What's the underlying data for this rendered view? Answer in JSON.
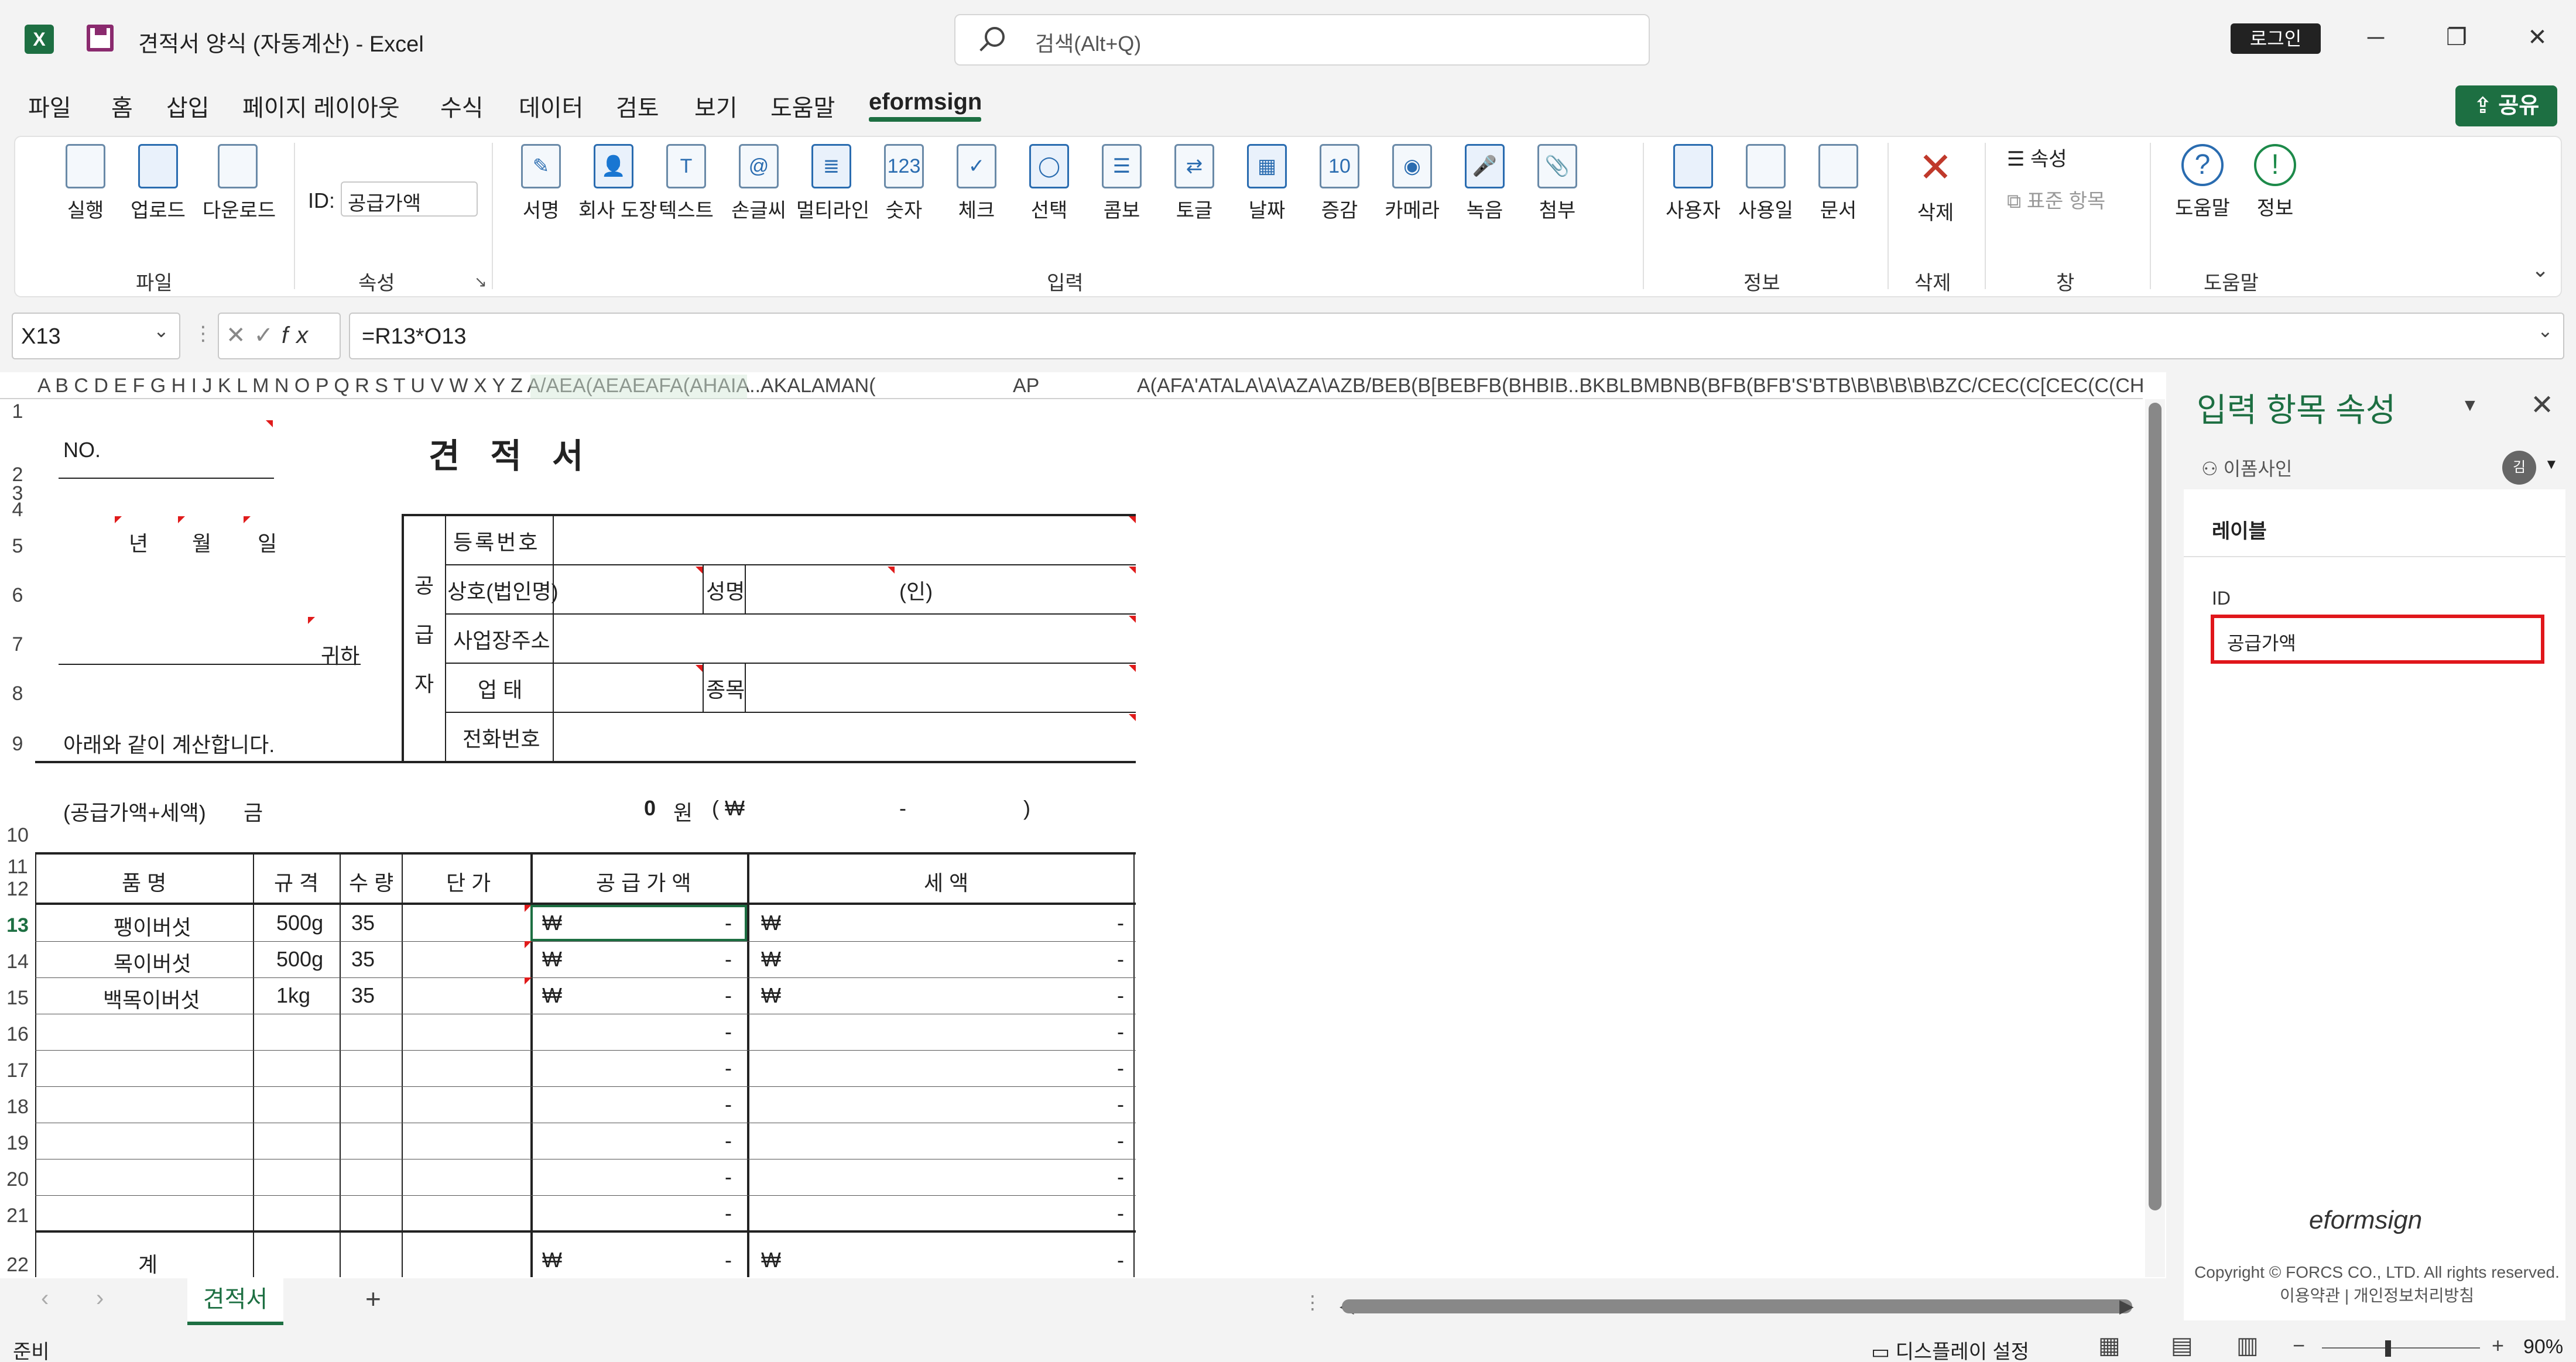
{
  "window": {
    "title": "견적서 양식 (자동계산)  -  Excel",
    "search_placeholder": "검색(Alt+Q)",
    "login": "로그인"
  },
  "menu": {
    "items": [
      "파일",
      "홈",
      "삽입",
      "페이지 레이아웃",
      "수식",
      "데이터",
      "검토",
      "보기",
      "도움말",
      "eformsign"
    ],
    "share": "공유"
  },
  "ribbon": {
    "file_group": {
      "name": "파일",
      "buttons": [
        "실행",
        "업로드",
        "다운로드"
      ]
    },
    "property_group": {
      "name": "속성",
      "id_label": "ID:",
      "id_value": "공급가액"
    },
    "input_group": {
      "name": "입력",
      "buttons": [
        "서명",
        "회사 도장",
        "텍스트",
        "손글씨",
        "멀티라인",
        "숫자",
        "체크",
        "선택",
        "콤보",
        "토글",
        "날짜",
        "증감",
        "카메라",
        "녹음",
        "첨부"
      ]
    },
    "info_group": {
      "name": "정보",
      "buttons": [
        "사용자",
        "사용일",
        "문서"
      ]
    },
    "delete_group": {
      "name": "삭제",
      "buttons": [
        "삭제"
      ]
    },
    "window_group": {
      "name": "창",
      "buttons": [
        "속성",
        "표준 항목"
      ]
    },
    "help_group": {
      "name": "도움말",
      "buttons": [
        "도움말",
        "정보"
      ]
    }
  },
  "formula": {
    "name_box": "X13",
    "formula": "=R13*O13"
  },
  "sheet": {
    "title": "견 적 서",
    "no_label": "NO.",
    "date": {
      "year": "년",
      "month": "월",
      "day": "일"
    },
    "to": "귀하",
    "note": "아래와 같이 계산합니다.",
    "supplier_label": [
      "공",
      "급",
      "자"
    ],
    "supplier_fields": {
      "reg_no": "등록번호",
      "company": "상호(법인명)",
      "name": "성명",
      "seal": "(인)",
      "address": "사업장주소",
      "business": "업 태",
      "item": "종목",
      "phone": "전화번호"
    },
    "total_row": {
      "label": "(공급가액+세액)",
      "amount_label": "금",
      "amount": "0",
      "won": "원",
      "open": "( ₩",
      "dash": "-",
      "close": ")"
    },
    "headers": [
      "품 명",
      "규 격",
      "수 량",
      "단 가",
      "공 급 가 액",
      "세 액"
    ],
    "items": [
      {
        "name": "팽이버섯",
        "spec": "500g",
        "qty": "35",
        "cur": "₩",
        "val": "-",
        "tcur": "₩",
        "tval": "-"
      },
      {
        "name": "목이버섯",
        "spec": "500g",
        "qty": "35",
        "cur": "₩",
        "val": "-",
        "tcur": "₩",
        "tval": "-"
      },
      {
        "name": "백목이버섯",
        "spec": "1kg",
        "qty": "35",
        "cur": "₩",
        "val": "-",
        "tcur": "₩",
        "tval": "-"
      }
    ],
    "empty_dash": "-",
    "sum_label": "계",
    "sum_cur": "₩",
    "column_letters": "A B C D E F G H I  J K L M N O P Q R S T U V W X Y Z A/AEA(AEAEAFA(AHAIA..AKALAMAN(",
    "column_letters_2": "AP",
    "column_letters_3": "A(AFA'ATALA\\A\\AZA\\AZB/BEB(B[BEBFB(BHBIB..BKBLBMBNB(BFB(BFB'S'BTB\\B\\B\\B\\B\\BZC/CEC(C[CEC(C(CHCIC.C"
  },
  "pane": {
    "title": "입력 항목 속성",
    "user": "이폼사인",
    "avatar": "김",
    "label": "레이블",
    "id_caption": "ID",
    "id_value": "공급가액",
    "brand": "eformsign",
    "copyright": "Copyright © FORCS CO., LTD. All rights reserved.",
    "links": "이용약관  |  개인정보처리방침"
  },
  "tabs": {
    "active": "견적서",
    "add": "+"
  },
  "status": {
    "ready": "준비",
    "display": "디스플레이 설정",
    "zoom": "90%"
  }
}
